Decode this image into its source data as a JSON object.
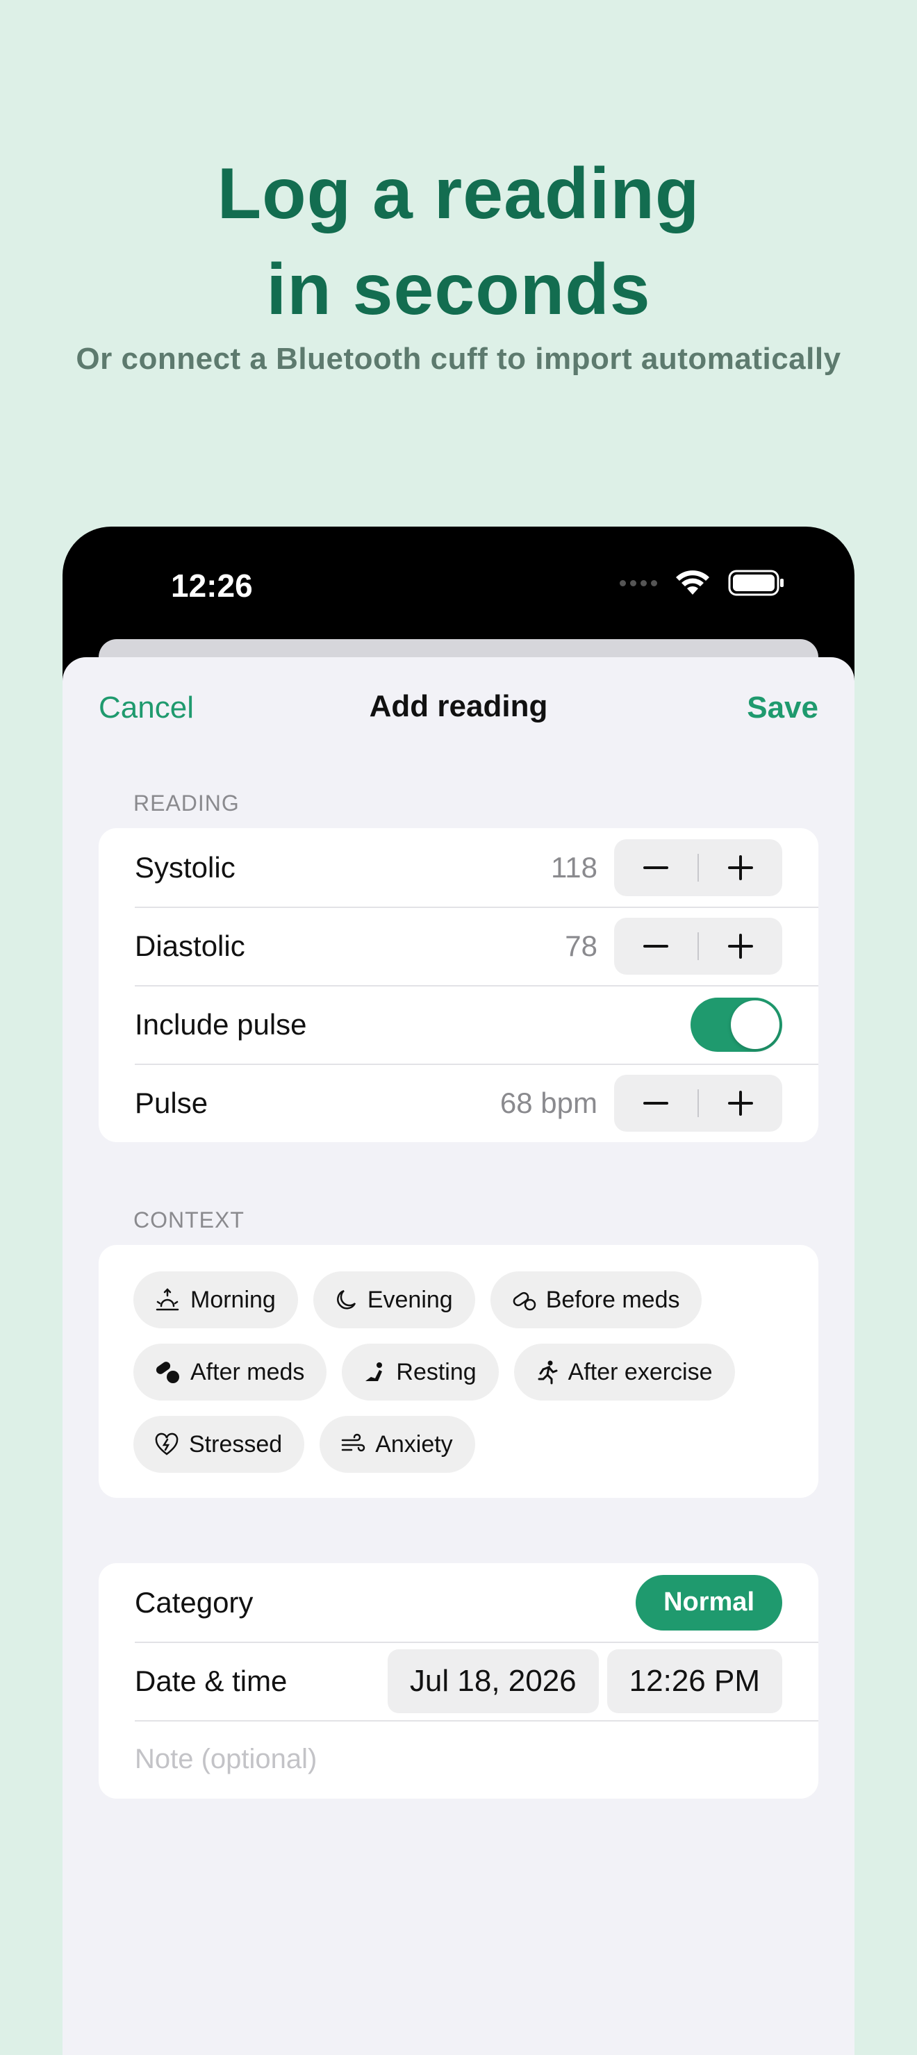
{
  "promo": {
    "headline_line1": "Log a reading",
    "headline_line2": "in seconds",
    "subtitle": "Or connect a Bluetooth cuff to import automatically"
  },
  "status_bar": {
    "time": "12:26"
  },
  "navbar": {
    "cancel": "Cancel",
    "title": "Add reading",
    "save": "Save"
  },
  "reading": {
    "section_label": "READING",
    "systolic": {
      "label": "Systolic",
      "value": "118"
    },
    "diastolic": {
      "label": "Diastolic",
      "value": "78"
    },
    "include_pulse": {
      "label": "Include pulse",
      "on": true
    },
    "pulse": {
      "label": "Pulse",
      "value": "68 bpm"
    }
  },
  "context": {
    "section_label": "CONTEXT",
    "chips": [
      {
        "label": "Morning",
        "icon": "sunrise-icon"
      },
      {
        "label": "Evening",
        "icon": "moon-icon"
      },
      {
        "label": "Before meds",
        "icon": "pill-icon"
      },
      {
        "label": "After meds",
        "icon": "pills-icon"
      },
      {
        "label": "Resting",
        "icon": "resting-icon"
      },
      {
        "label": "After exercise",
        "icon": "running-icon"
      },
      {
        "label": "Stressed",
        "icon": "heart-bolt-icon"
      },
      {
        "label": "Anxiety",
        "icon": "wind-icon"
      }
    ]
  },
  "details": {
    "category_label": "Category",
    "category_value": "Normal",
    "datetime_label": "Date & time",
    "date": "Jul 18, 2026",
    "time": "12:26 PM",
    "note_placeholder": "Note (optional)"
  },
  "colors": {
    "accent": "#1f9a6e",
    "headline": "#136d50",
    "background": "#ddf0e7"
  }
}
